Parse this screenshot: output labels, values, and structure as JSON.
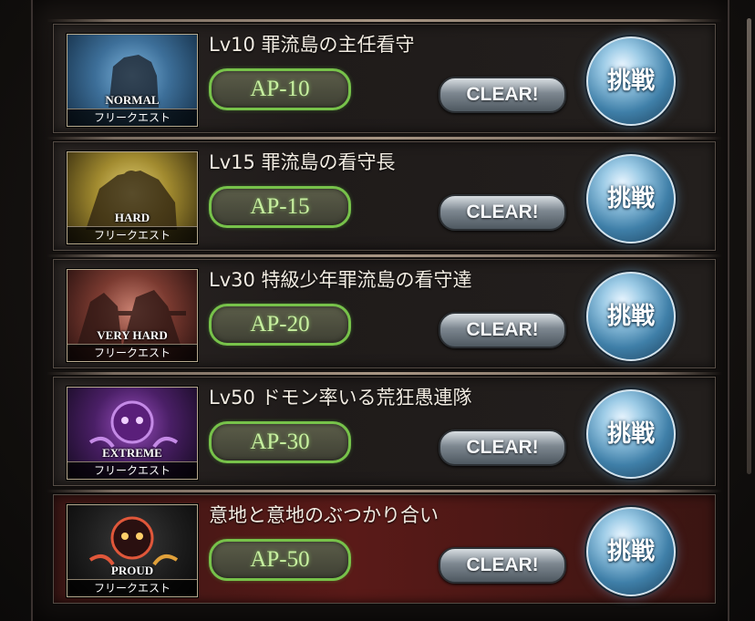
{
  "quests": [
    {
      "title": "Lv10 罪流島の主任看守",
      "difficulty": "NORMAL",
      "type": "フリークエスト",
      "ap": "AP-10",
      "status": "CLEAR!",
      "action": "挑戦",
      "diff_color": "#2f6fa8"
    },
    {
      "title": "Lv15 罪流島の看守長",
      "difficulty": "HARD",
      "type": "フリークエスト",
      "ap": "AP-15",
      "status": "CLEAR!",
      "action": "挑戦",
      "diff_color": "#b8a23a"
    },
    {
      "title": "Lv30 特級少年罪流島の看守達",
      "difficulty": "VERY HARD",
      "type": "フリークエスト",
      "ap": "AP-20",
      "status": "CLEAR!",
      "action": "挑戦",
      "diff_color": "#a1473a"
    },
    {
      "title": "Lv50 ドモン率いる荒狂愚連隊",
      "difficulty": "EXTREME",
      "type": "フリークエスト",
      "ap": "AP-30",
      "status": "CLEAR!",
      "action": "挑戦",
      "diff_color": "#6a2a8a"
    },
    {
      "title": "意地と意地のぶつかり合い",
      "difficulty": "PROUD",
      "type": "フリークエスト",
      "ap": "AP-50",
      "status": "CLEAR!",
      "action": "挑戦",
      "diff_color": "#8a2a20"
    }
  ]
}
